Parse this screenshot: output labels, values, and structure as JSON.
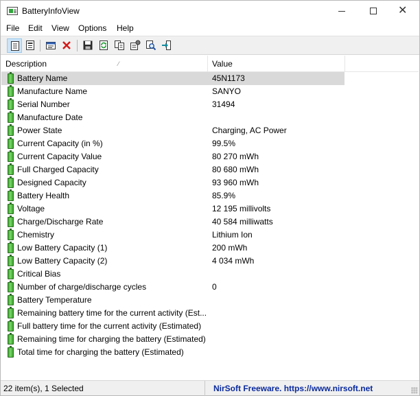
{
  "window": {
    "title": "BatteryInfoView",
    "controls": {
      "minimize": "–",
      "maximize": "□",
      "close": "✕"
    }
  },
  "menu": [
    "File",
    "Edit",
    "View",
    "Options",
    "Help"
  ],
  "toolbar": [
    {
      "name": "html-report-all-icon",
      "active": true
    },
    {
      "name": "html-report-selected-icon",
      "active": false
    },
    {
      "name": "properties-icon",
      "active": false
    },
    {
      "name": "delete-icon",
      "active": false
    },
    {
      "name": "save-icon",
      "active": false
    },
    {
      "name": "refresh-icon",
      "active": false
    },
    {
      "name": "copy-icon",
      "active": false
    },
    {
      "name": "options-icon",
      "active": false
    },
    {
      "name": "find-icon",
      "active": false
    },
    {
      "name": "exit-icon",
      "active": false
    }
  ],
  "list": {
    "columns": {
      "description": "Description",
      "value": "Value",
      "sort_indicator": "⁄"
    },
    "rows": [
      {
        "description": "Battery Name",
        "value": "45N1173",
        "selected": true
      },
      {
        "description": "Manufacture Name",
        "value": "SANYO"
      },
      {
        "description": "Serial Number",
        "value": "31494"
      },
      {
        "description": "Manufacture Date",
        "value": ""
      },
      {
        "description": "Power State",
        "value": "Charging, AC Power"
      },
      {
        "description": "Current Capacity (in %)",
        "value": "99.5%"
      },
      {
        "description": "Current Capacity Value",
        "value": "80 270 mWh"
      },
      {
        "description": "Full Charged Capacity",
        "value": "80 680 mWh"
      },
      {
        "description": "Designed Capacity",
        "value": "93 960 mWh"
      },
      {
        "description": "Battery Health",
        "value": "85.9%"
      },
      {
        "description": "Voltage",
        "value": "12 195 millivolts"
      },
      {
        "description": "Charge/Discharge Rate",
        "value": "40 584 milliwatts"
      },
      {
        "description": "Chemistry",
        "value": "Lithium Ion"
      },
      {
        "description": "Low Battery Capacity (1)",
        "value": "200 mWh"
      },
      {
        "description": "Low Battery Capacity (2)",
        "value": "4 034 mWh"
      },
      {
        "description": "Critical Bias",
        "value": ""
      },
      {
        "description": "Number of charge/discharge cycles",
        "value": "0"
      },
      {
        "description": "Battery Temperature",
        "value": ""
      },
      {
        "description": "Remaining battery time for the current activity (Est...",
        "value": ""
      },
      {
        "description": "Full battery time for the current activity (Estimated)",
        "value": ""
      },
      {
        "description": "Remaining time for charging the battery (Estimated)",
        "value": ""
      },
      {
        "description": "Total  time for charging the battery (Estimated)",
        "value": ""
      }
    ]
  },
  "status": {
    "items": "22 item(s), 1 Selected",
    "brand": "NirSoft Freeware. https://www.nirsoft.net"
  }
}
